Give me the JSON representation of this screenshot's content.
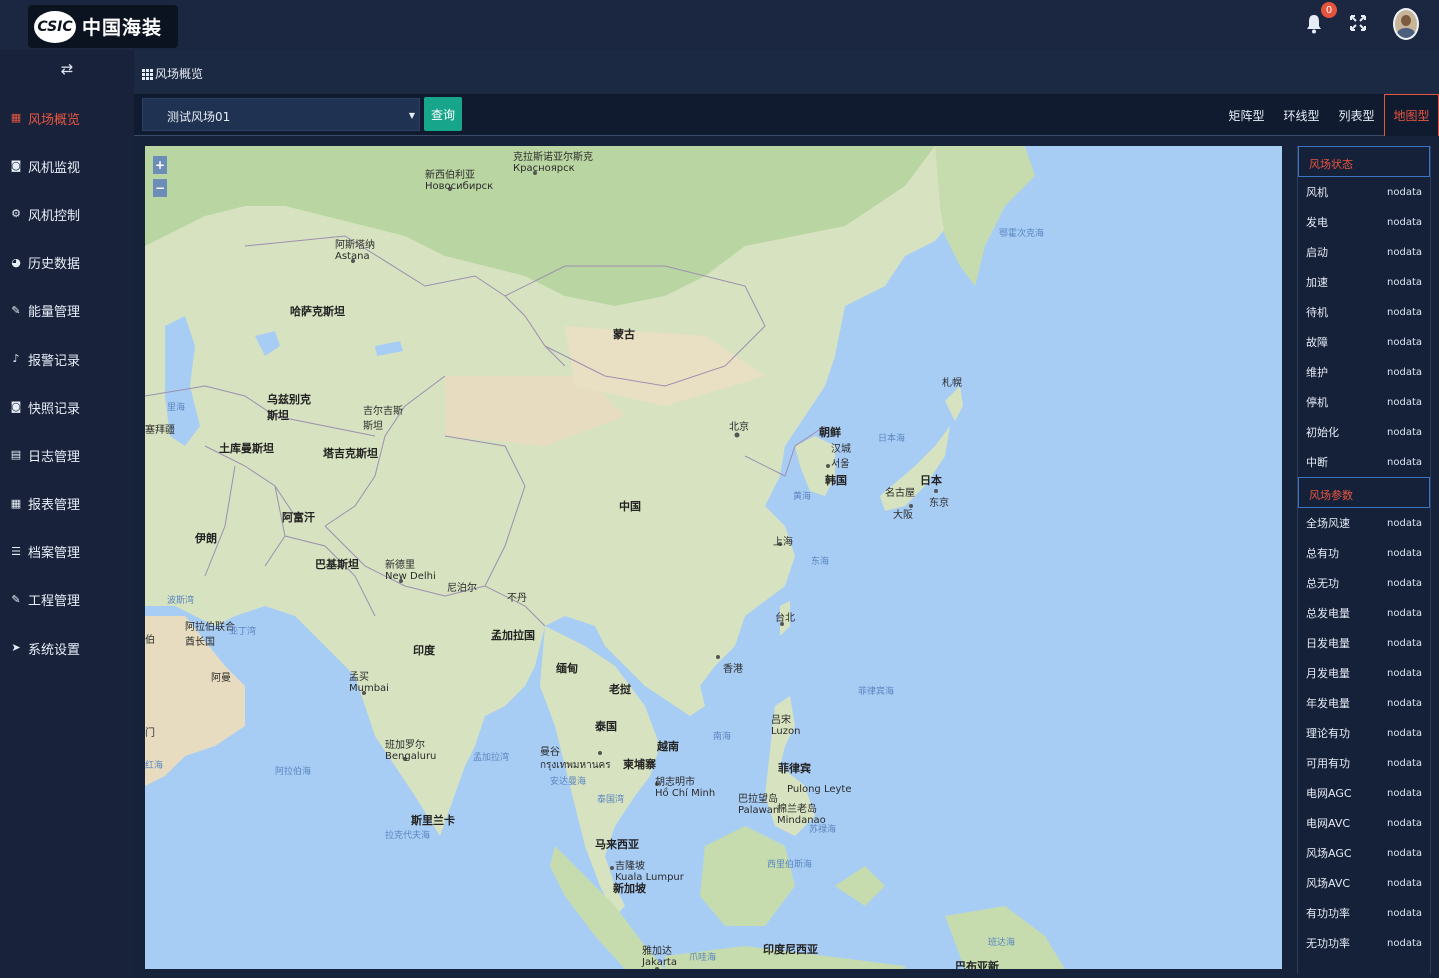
{
  "header": {
    "logo_badge": "CSIC",
    "logo_text": "中国海装",
    "notification_count": "0"
  },
  "sidebar": {
    "items": [
      {
        "label": "风场概览",
        "icon": "grid-icon",
        "active": true
      },
      {
        "label": "风机监视",
        "icon": "camera-icon",
        "active": false
      },
      {
        "label": "风机控制",
        "icon": "gear-icon",
        "active": false
      },
      {
        "label": "历史数据",
        "icon": "pie-chart-icon",
        "active": false
      },
      {
        "label": "能量管理",
        "icon": "wrench-icon",
        "active": false
      },
      {
        "label": "报警记录",
        "icon": "bell-icon",
        "active": false
      },
      {
        "label": "快照记录",
        "icon": "camera-icon",
        "active": false
      },
      {
        "label": "日志管理",
        "icon": "file-icon",
        "active": false
      },
      {
        "label": "报表管理",
        "icon": "table-icon",
        "active": false
      },
      {
        "label": "档案管理",
        "icon": "list-icon",
        "active": false
      },
      {
        "label": "工程管理",
        "icon": "wrench-icon",
        "active": false
      },
      {
        "label": "系统设置",
        "icon": "send-icon",
        "active": false
      }
    ]
  },
  "breadcrumb": {
    "label": "风场概览"
  },
  "toolbar": {
    "select_value": "测试风场01",
    "query_label": "查询",
    "tabs": [
      {
        "label": "矩阵型",
        "active": false
      },
      {
        "label": "环线型",
        "active": false
      },
      {
        "label": "列表型",
        "active": false
      },
      {
        "label": "地图型",
        "active": true
      }
    ]
  },
  "map": {
    "labels": {
      "novosibirsk": "新西伯利亚\nНовосибирск",
      "krasnoyarsk": "克拉斯诺亚尔斯克\nКрасноярск",
      "astana": "阿斯塔纳\nAstana",
      "kazakhstan": "哈萨克斯坦",
      "mongolia": "蒙古",
      "uzbekistan": "乌兹别克斯坦",
      "kyrgyzstan": "吉尔吉斯斯坦",
      "turkmenistan": "土库曼斯坦",
      "tajikistan": "塔吉克斯坦",
      "afghanistan": "阿富汗",
      "iran": "伊朗",
      "pakistan": "巴基斯坦",
      "china": "中国",
      "beijing": "北京",
      "korea_north": "朝鲜",
      "seoul": "汉城\n서울",
      "korea_south": "韩国",
      "japan": "日本",
      "tokyo": "东京",
      "nagoya": "名古屋",
      "osaka": "大阪",
      "sapporo": "札幌",
      "shanghai": "上海",
      "taipei": "台北",
      "hongkong": "香港",
      "india": "印度",
      "newdelhi": "新德里\nNew Delhi",
      "mumbai": "孟买\nMumbai",
      "bengaluru": "班加罗尔\nBengaluru",
      "nepal": "尼泊尔",
      "bhutan": "不丹",
      "bangladesh": "孟加拉国",
      "myanmar": "缅甸",
      "laos": "老挝",
      "thailand": "泰国",
      "vietnam": "越南",
      "cambodia": "柬埔寨",
      "bangkok": "曼谷\nกรุงเทพมหานคร",
      "hochiminh": "胡志明市\nHồ Chí Minh",
      "philippines": "菲律宾",
      "luzon": "吕宋\nLuzon",
      "palawan": "巴拉望岛\nPalawan",
      "mindanao": "棉兰老岛\nMindanao",
      "pulong": "Pulong Leyte",
      "malaysia": "马来西亚",
      "kualalumpur": "吉隆坡\nKuala Lumpur",
      "singapore": "新加坡",
      "srilanka": "斯里兰卡",
      "indonesia": "印度尼西亚",
      "jakarta": "雅加达\nJakarta",
      "uae": "阿拉伯联合\n酋长国",
      "oman": "阿曼",
      "azerbaijan": "塞拜疆",
      "sea_okhotsk": "鄂霍次克海",
      "sea_japan": "日本海",
      "sea_yellow": "黄海",
      "sea_east": "东海",
      "sea_south": "南海",
      "sea_philippine": "菲律宾海",
      "sea_arabian": "阿拉伯海",
      "sea_bengal": "孟加拉湾",
      "sea_andaman": "安达曼海",
      "sea_thailand": "泰国湾",
      "sea_celebes": "西里伯斯海",
      "sea_banda": "班达海",
      "sea_java": "爪哇海",
      "sea_laccadive": "拉克代夫海",
      "sea_red": "红海",
      "sea_persian": "波斯湾",
      "sea_caspian": "里海",
      "papua": "巴布亚新",
      "aden": "亚丁湾",
      "yibo": "伯",
      "men": "门",
      "sulu": "苏禄海"
    }
  },
  "panel": {
    "status_header": "风场状态",
    "status_rows": [
      {
        "label": "风机",
        "value": "nodata"
      },
      {
        "label": "发电",
        "value": "nodata"
      },
      {
        "label": "启动",
        "value": "nodata"
      },
      {
        "label": "加速",
        "value": "nodata"
      },
      {
        "label": "待机",
        "value": "nodata"
      },
      {
        "label": "故障",
        "value": "nodata"
      },
      {
        "label": "维护",
        "value": "nodata"
      },
      {
        "label": "停机",
        "value": "nodata"
      },
      {
        "label": "初始化",
        "value": "nodata"
      },
      {
        "label": "中断",
        "value": "nodata"
      }
    ],
    "params_header": "风场参数",
    "param_rows": [
      {
        "label": "全场风速",
        "value": "nodata"
      },
      {
        "label": "总有功",
        "value": "nodata"
      },
      {
        "label": "总无功",
        "value": "nodata"
      },
      {
        "label": "总发电量",
        "value": "nodata"
      },
      {
        "label": "日发电量",
        "value": "nodata"
      },
      {
        "label": "月发电量",
        "value": "nodata"
      },
      {
        "label": "年发电量",
        "value": "nodata"
      },
      {
        "label": "理论有功",
        "value": "nodata"
      },
      {
        "label": "可用有功",
        "value": "nodata"
      },
      {
        "label": "电网AGC",
        "value": "nodata"
      },
      {
        "label": "电网AVC",
        "value": "nodata"
      },
      {
        "label": "风场AGC",
        "value": "nodata"
      },
      {
        "label": "风场AVC",
        "value": "nodata"
      },
      {
        "label": "有功功率",
        "value": "nodata"
      },
      {
        "label": "无功功率",
        "value": "nodata"
      }
    ]
  },
  "colors": {
    "accent": "#e8553f",
    "query_button": "#17a58b",
    "sidebar_bg": "#18233b",
    "map_sea": "#a8cdf5"
  }
}
